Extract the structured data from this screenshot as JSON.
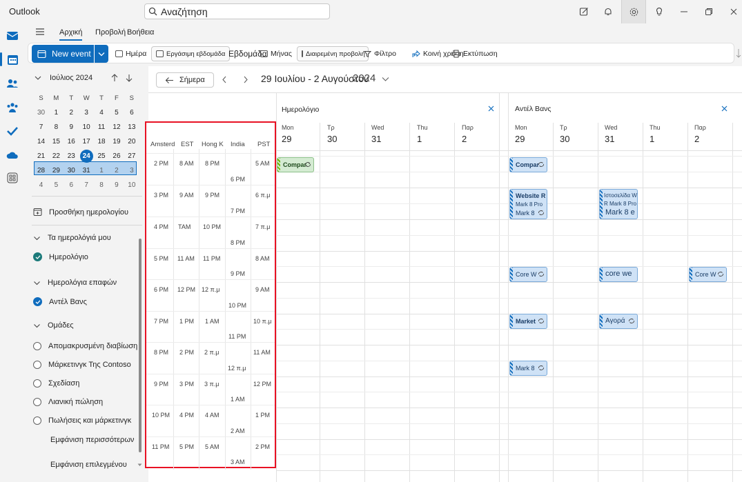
{
  "app": {
    "title": "Outlook"
  },
  "search": {
    "placeholder": "Αναζήτηση"
  },
  "ribbon": {
    "tabs": [
      "Αρχική",
      "Προβολή",
      "Βοήθεια"
    ],
    "new_event": "New event",
    "day": "Ημέρα",
    "work_week": "Εργάσιμη εβδομάδα",
    "week": "Εβδομάδα",
    "month": "Μήνας",
    "split_view": "Διαιρεμένη προβολή",
    "filter": "Φίλτρο",
    "share": "Κοινή χρήση",
    "print": "Εκτύπωση"
  },
  "mini_calendar": {
    "month_label": "Ιούλιος 2024",
    "weekday_headers": [
      "S",
      "M",
      "T",
      "W",
      "T",
      "F",
      "S"
    ],
    "weeks": [
      [
        "30",
        "1",
        "2",
        "3",
        "4",
        "5",
        "6"
      ],
      [
        "7",
        "8",
        "9",
        "10",
        "11",
        "12",
        "13"
      ],
      [
        "14",
        "15",
        "16",
        "17",
        "18",
        "19",
        "20"
      ],
      [
        "21",
        "22",
        "23",
        "24",
        "25",
        "26",
        "27"
      ],
      [
        "28",
        "29",
        "30",
        "31",
        "1",
        "2",
        "3"
      ],
      [
        "4",
        "5",
        "6",
        "7",
        "8",
        "9",
        "10"
      ]
    ],
    "today": "24"
  },
  "left_panel": {
    "add_calendar": "Προσθήκη ημερολογίου",
    "my_calendars": "Τα ημερολόγιά μου",
    "calendar": "Ημερολόγιο",
    "contact_calendars": "Ημερολόγια επαφών",
    "contact_name": "Αντέλ Βανς",
    "groups": "Ομάδες",
    "group_items": [
      "Απομακρυσμένη διαβίωση",
      "Μάρκετινγκ Της Contoso",
      "Σχεδίαση",
      "Λιανική πώληση",
      "Πωλήσεις και μάρκετινγκ"
    ],
    "show_more": "Εμφάνιση περισσότερων",
    "show_selected": "Εμφάνιση επιλεγμένου"
  },
  "main": {
    "today_btn": "Σήμερα",
    "date_range": "29 Ιουλίου - 2 Αυγούστου",
    "year": "2024",
    "pane1_title": "Ημερολόγιο",
    "pane2_title": "Αντέλ Βανς",
    "days": [
      {
        "name": "Mon",
        "date": "29"
      },
      {
        "name": "Τρ",
        "date": "30"
      },
      {
        "name": "Wed",
        "date": "31"
      },
      {
        "name": "Thu",
        "date": "1"
      },
      {
        "name": "Παρ",
        "date": "2"
      }
    ],
    "events": {
      "p1_company": "Compar",
      "p2_company": "Compar",
      "p2_website_title": "Website R",
      "p2_website_line2": "Mark 8 Pro",
      "p2_website_line3": "Mark 8",
      "p2_wed_website_title": "Ιστοσελίδα Web",
      "p2_wed_website_line2": "R Mark 8 Pro",
      "p2_wed_website_line3": "Mark 8 e",
      "p2_core_mon": "Core W",
      "p2_core_wed": "core we",
      "p2_core_fri": "Core W",
      "p2_market_mon": "Market",
      "p2_market_wed": "Αγορά",
      "p2_mark8_mon": "Mark 8"
    }
  },
  "timezones": {
    "headers": [
      "Amsterd",
      "EST",
      "Hong K",
      "India",
      "PST"
    ],
    "amsterdam": [
      "2 PM",
      "3 PM",
      "4 PM",
      "5 PM",
      "6 PM",
      "7 PM",
      "8 PM",
      "9 PM",
      "10 PM",
      "11 PM"
    ],
    "est": [
      "8 AM",
      "9 AM",
      "ΤΑΜ",
      "11 AM",
      "12 PM",
      "1 PM",
      "2 PM",
      "3 PM",
      "4 PM",
      "5 PM"
    ],
    "hongkong": [
      "8 PM",
      "9 PM",
      "10 PM",
      "11 PM",
      "12 π.μ",
      "1 AM",
      "2 π.μ",
      "3 π.μ",
      "4 AM",
      "5 AM"
    ],
    "india": [
      "6 PM",
      "7 PM",
      "8 PM",
      "9 PM",
      "10 PM",
      "11 PM",
      "12 π.μ",
      "1 AM",
      "2 AM",
      "3 AM"
    ],
    "pst": [
      "5 AM",
      "6 π.μ",
      "7 π.μ",
      "8 AM",
      "9 AM",
      "10 π.μ",
      "11 AM",
      "12 PM",
      "1 PM",
      "2 PM"
    ]
  },
  "colors": {
    "accent": "#0f6cbd",
    "highlight_border": "#e81123",
    "event_blue": "#cfe2f6",
    "event_green": "#d4ebd2"
  }
}
